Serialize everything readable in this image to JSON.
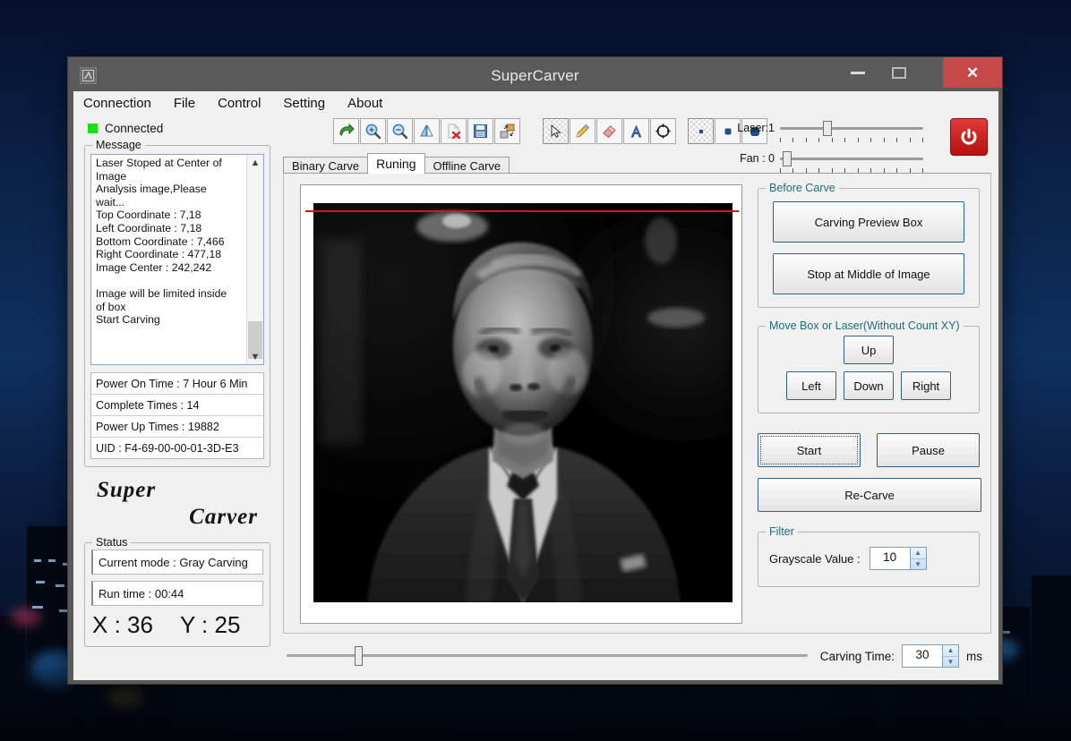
{
  "window": {
    "title": "SuperCarver",
    "app_icon": "app-window-icon",
    "minimize_label": "–",
    "maximize_label": "□",
    "close_label": "✕"
  },
  "menubar": {
    "items": [
      {
        "label": "Connection"
      },
      {
        "label": "File"
      },
      {
        "label": "Control"
      },
      {
        "label": "Setting"
      },
      {
        "label": "About"
      }
    ]
  },
  "sidebar": {
    "connection_status": "Connected",
    "connection_led_color": "#17e017",
    "message": {
      "legend": "Message",
      "text": "Laser Stoped at Center of\nImage\nAnalysis image,Please\nwait...\nTop Coordinate : 7,18\nLeft Coordinate : 7,18\nBottom Coordinate : 7,466\nRight Coordinate : 477,18\nImage Center : 242,242\n\nImage will be limited inside\nof box\nStart Carving"
    },
    "info_rows": [
      {
        "label": "Power On Time : 7 Hour 6 Min"
      },
      {
        "label": "Complete Times : 14"
      },
      {
        "label": "Power Up Times : 19882"
      },
      {
        "label": "UID : F4-69-00-00-01-3D-E3"
      }
    ],
    "brand": {
      "line1": "Super",
      "line2": "Carver"
    },
    "status": {
      "legend": "Status",
      "current_mode": "Current mode : Gray Carving",
      "run_time": "Run time :  00:44",
      "x": "X : 36",
      "y": "Y : 25"
    }
  },
  "toolbar": {
    "file_buttons": [
      {
        "name": "open-image-icon",
        "title": "Open"
      },
      {
        "name": "zoom-in-icon",
        "title": "Zoom In"
      },
      {
        "name": "zoom-out-icon",
        "title": "Zoom Out"
      },
      {
        "name": "mirror-icon",
        "title": "Mirror"
      },
      {
        "name": "delete-file-icon",
        "title": "Delete"
      },
      {
        "name": "save-icon",
        "title": "Save"
      },
      {
        "name": "resize-icon",
        "title": "Resize"
      }
    ],
    "tool_buttons": [
      {
        "name": "pointer-icon",
        "title": "Select",
        "checked": true
      },
      {
        "name": "pencil-icon",
        "title": "Pencil",
        "checked": false
      },
      {
        "name": "eraser-icon",
        "title": "Eraser",
        "checked": false
      },
      {
        "name": "text-icon",
        "title": "Text",
        "checked": false
      },
      {
        "name": "target-icon",
        "title": "Target",
        "checked": false
      }
    ],
    "size_buttons": [
      {
        "name": "brush-small-icon",
        "title": "Small",
        "checked": true
      },
      {
        "name": "brush-medium-icon",
        "title": "Medium",
        "checked": false
      },
      {
        "name": "brush-large-icon",
        "title": "Large",
        "checked": false
      }
    ],
    "laser": {
      "label": "Laser:1",
      "value": 1,
      "thumb_percent": 31
    },
    "fan": {
      "label": "Fan : 0",
      "value": 0,
      "thumb_percent": 5
    },
    "power_button": "power-icon",
    "power_button_color": "#c6140f"
  },
  "tabs": [
    {
      "label": "Binary Carve",
      "active": false
    },
    {
      "label": "Runing",
      "active": true
    },
    {
      "label": "Offline Carve",
      "active": false
    }
  ],
  "preview": {
    "name": "carving-preview-image",
    "description": "Grayscale portrait of a man in a suit and tie",
    "laser_line_color": "#e31010"
  },
  "controls": {
    "before_carve": {
      "legend": "Before Carve",
      "buttons": [
        {
          "label": "Carving Preview Box",
          "name": "carving-preview-box-button"
        },
        {
          "label": "Stop at Middle of Image",
          "name": "stop-at-middle-button"
        }
      ]
    },
    "move_box": {
      "legend": "Move Box or Laser(Without Count XY)",
      "up": "Up",
      "left": "Left",
      "down": "Down",
      "right": "Right"
    },
    "actions": {
      "start": "Start",
      "pause": "Pause",
      "recarve": "Re-Carve"
    },
    "filter": {
      "legend": "Filter",
      "label": "Grayscale Value :",
      "value": "10"
    }
  },
  "bottom": {
    "slider_thumb_percent": 13,
    "carving_time_label": "Carving Time:",
    "carving_time_value": "30",
    "carving_time_unit": "ms"
  },
  "legend_color": "#1f6d78"
}
